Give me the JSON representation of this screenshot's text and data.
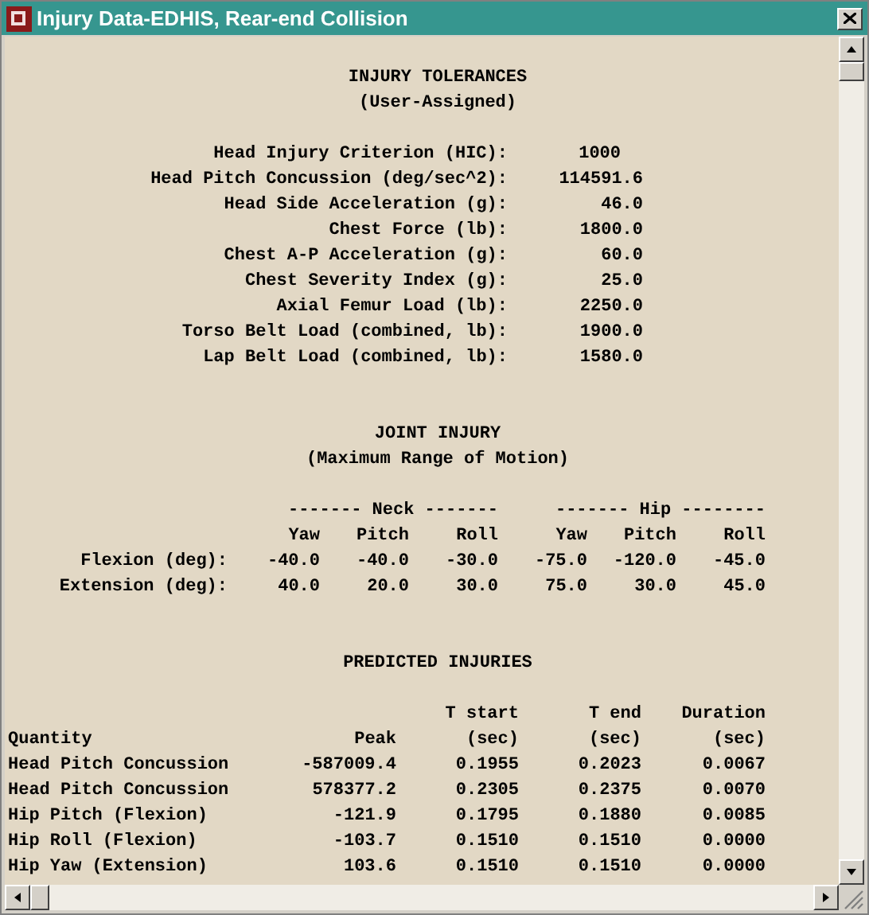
{
  "window": {
    "title": "Injury Data-EDHIS, Rear-end Collision"
  },
  "tolerances": {
    "title": "INJURY TOLERANCES",
    "subtitle": "(User-Assigned)",
    "rows": [
      {
        "label": "Head Injury Criterion (HIC):",
        "value": "1000"
      },
      {
        "label": "Head Pitch Concussion (deg/sec^2):",
        "value": "114591.6"
      },
      {
        "label": "Head Side Acceleration (g):",
        "value": "46.0"
      },
      {
        "label": "Chest Force (lb):",
        "value": "1800.0"
      },
      {
        "label": "Chest A-P Acceleration (g):",
        "value": "60.0"
      },
      {
        "label": "Chest Severity Index (g):",
        "value": "25.0"
      },
      {
        "label": "Axial Femur Load (lb):",
        "value": "2250.0"
      },
      {
        "label": "Torso Belt Load (combined, lb):",
        "value": "1900.0"
      },
      {
        "label": "Lap Belt Load (combined, lb):",
        "value": "1580.0"
      }
    ]
  },
  "joint_injury": {
    "title": "JOINT INJURY",
    "subtitle": "(Maximum Range of Motion)",
    "groups": [
      "------- Neck -------",
      "------- Hip --------"
    ],
    "columns": [
      "Yaw",
      "Pitch",
      "Roll",
      "Yaw",
      "Pitch",
      "Roll"
    ],
    "rows": [
      {
        "label": "Flexion (deg):",
        "values": [
          "-40.0",
          "-40.0",
          "-30.0",
          "-75.0",
          "-120.0",
          "-45.0"
        ]
      },
      {
        "label": "Extension (deg):",
        "values": [
          "40.0",
          "20.0",
          "30.0",
          "75.0",
          "30.0",
          "45.0"
        ]
      }
    ]
  },
  "predicted_injuries": {
    "title": "PREDICTED INJURIES",
    "columns": [
      {
        "lines": [
          "Quantity"
        ]
      },
      {
        "lines": [
          "Peak"
        ]
      },
      {
        "lines": [
          "T start",
          "(sec)"
        ]
      },
      {
        "lines": [
          "T end",
          "(sec)"
        ]
      },
      {
        "lines": [
          "Duration",
          "(sec)"
        ]
      }
    ],
    "rows": [
      [
        "Head Pitch Concussion",
        "-587009.4",
        "0.1955",
        "0.2023",
        "0.0067"
      ],
      [
        "Head Pitch Concussion",
        "578377.2",
        "0.2305",
        "0.2375",
        "0.0070"
      ],
      [
        "Hip Pitch (Flexion)",
        "-121.9",
        "0.1795",
        "0.1880",
        "0.0085"
      ],
      [
        "Hip Roll (Flexion)",
        "-103.7",
        "0.1510",
        "0.1510",
        "0.0000"
      ],
      [
        "Hip Yaw (Extension)",
        "103.6",
        "0.1510",
        "0.1510",
        "0.0000"
      ]
    ]
  }
}
